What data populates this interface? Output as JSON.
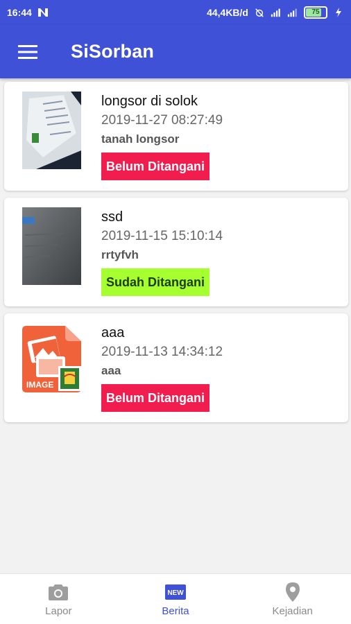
{
  "status_bar": {
    "time": "16:44",
    "net_speed": "44,4KB/d",
    "battery": "75"
  },
  "app_bar": {
    "title": "SiSorban",
    "menu_icon": "hamburger-menu-icon"
  },
  "reports": [
    {
      "title": "longsor di solok",
      "datetime": "2019-11-27 08:27:49",
      "description": "tanah longsor",
      "status": "Belum Ditangani",
      "status_color": "#f21d4f"
    },
    {
      "title": "ssd",
      "datetime": "2019-11-15 15:10:14",
      "description": "rrtyfvh",
      "status": "Sudah Ditangani",
      "status_color": "#a6ff2e"
    },
    {
      "title": "aaa",
      "datetime": "2019-11-13 14:34:12",
      "description": "aaa",
      "status": "Belum Ditangani",
      "status_color": "#f21d4f",
      "placeholder_text": "IMAGE"
    }
  ],
  "bottom_nav": [
    {
      "label": "Lapor",
      "icon": "camera-icon",
      "active": false
    },
    {
      "label": "Berita",
      "icon": "new-badge-icon",
      "badge_text": "NEW",
      "active": true
    },
    {
      "label": "Kejadian",
      "icon": "location-pin-icon",
      "active": false
    }
  ],
  "colors": {
    "primary": "#3f51d6",
    "status_unhandled": "#f21d4f",
    "status_handled": "#a6ff2e"
  }
}
